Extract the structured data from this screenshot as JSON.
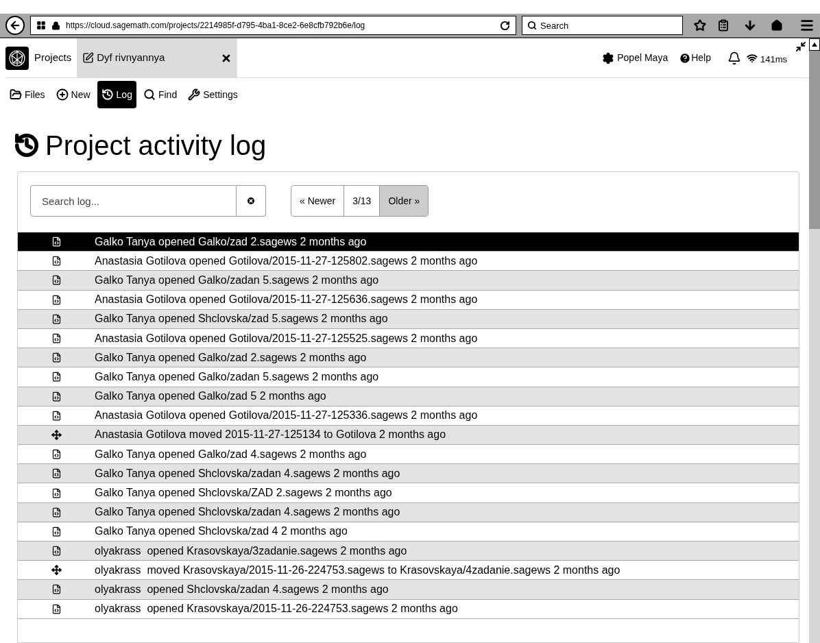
{
  "browser": {
    "url": "https://cloud.sagemath.com/projects/2214985f-d795-4ba1-8ce2-6e8cfb792b6e/log",
    "search_placeholder": "Search"
  },
  "header": {
    "projects_label": "Projects",
    "tab": {
      "label": "Dyf rivnyannya"
    },
    "user": "Popel Maya",
    "help": "Help",
    "ping": "141ms"
  },
  "nav": [
    {
      "label": "Files",
      "selected": false
    },
    {
      "label": "New",
      "selected": false
    },
    {
      "label": "Log",
      "selected": true
    },
    {
      "label": "Find",
      "selected": false
    },
    {
      "label": "Settings",
      "selected": false
    }
  ],
  "title": "Project activity log",
  "search": {
    "placeholder": "Search log..."
  },
  "pager": {
    "newer": "« Newer",
    "page": "3/13",
    "older": "Older »"
  },
  "rows": [
    {
      "kind": "open",
      "text": "Galko Tanya opened Galko/zad 2.sagews 2 months ago",
      "selected": true
    },
    {
      "kind": "open",
      "text": "Anastasia Gotilova opened Gotilova/2015-11-27-125802.sagews 2 months ago",
      "selected": false
    },
    {
      "kind": "open",
      "text": "Galko Tanya opened Galko/zadan 5.sagews 2 months ago",
      "selected": false
    },
    {
      "kind": "open",
      "text": "Anastasia Gotilova opened Gotilova/2015-11-27-125636.sagews 2 months ago",
      "selected": false
    },
    {
      "kind": "open",
      "text": "Galko Tanya opened Shclovska/zad 5.sagews 2 months ago",
      "selected": false
    },
    {
      "kind": "open",
      "text": "Anastasia Gotilova opened Gotilova/2015-11-27-125525.sagews 2 months ago",
      "selected": false
    },
    {
      "kind": "open",
      "text": "Galko Tanya opened Galko/zad 2.sagews 2 months ago",
      "selected": false
    },
    {
      "kind": "open",
      "text": "Galko Tanya opened Galko/zadan 5.sagews 2 months ago",
      "selected": false
    },
    {
      "kind": "open",
      "text": "Galko Tanya opened Galko/zad 5 2 months ago",
      "selected": false
    },
    {
      "kind": "open",
      "text": "Anastasia Gotilova opened Gotilova/2015-11-27-125336.sagews 2 months ago",
      "selected": false
    },
    {
      "kind": "move",
      "text": "Anastasia Gotilova moved 2015-11-27-125134 to Gotilova 2 months ago",
      "selected": false
    },
    {
      "kind": "open",
      "text": "Galko Tanya opened Galko/zad 4.sagews 2 months ago",
      "selected": false
    },
    {
      "kind": "open",
      "text": "Galko Tanya opened Shclovska/zadan 4.sagews 2 months ago",
      "selected": false
    },
    {
      "kind": "open",
      "text": "Galko Tanya opened Shclovska/ZAD 2.sagews 2 months ago",
      "selected": false
    },
    {
      "kind": "open",
      "text": "Galko Tanya opened Shclovska/zadan 4.sagews 2 months ago",
      "selected": false
    },
    {
      "kind": "open",
      "text": "Galko Tanya opened Shclovska/zad 4 2 months ago",
      "selected": false
    },
    {
      "kind": "open",
      "text": "olyakrass  opened Krasovskaya/3zadanie.sagews 2 months ago",
      "selected": false
    },
    {
      "kind": "move",
      "text": "olyakrass  moved Krasovskaya/2015-11-26-224753.sagews to Krasovskaya/4zadanie.sagews 2 months ago",
      "selected": false
    },
    {
      "kind": "open",
      "text": "olyakrass  opened Shclovska/zadan 4.sagews 2 months ago",
      "selected": false
    },
    {
      "kind": "open",
      "text": "olyakrass  opened Krasovskaya/2015-11-26-224753.sagews 2 months ago",
      "selected": false
    }
  ]
}
